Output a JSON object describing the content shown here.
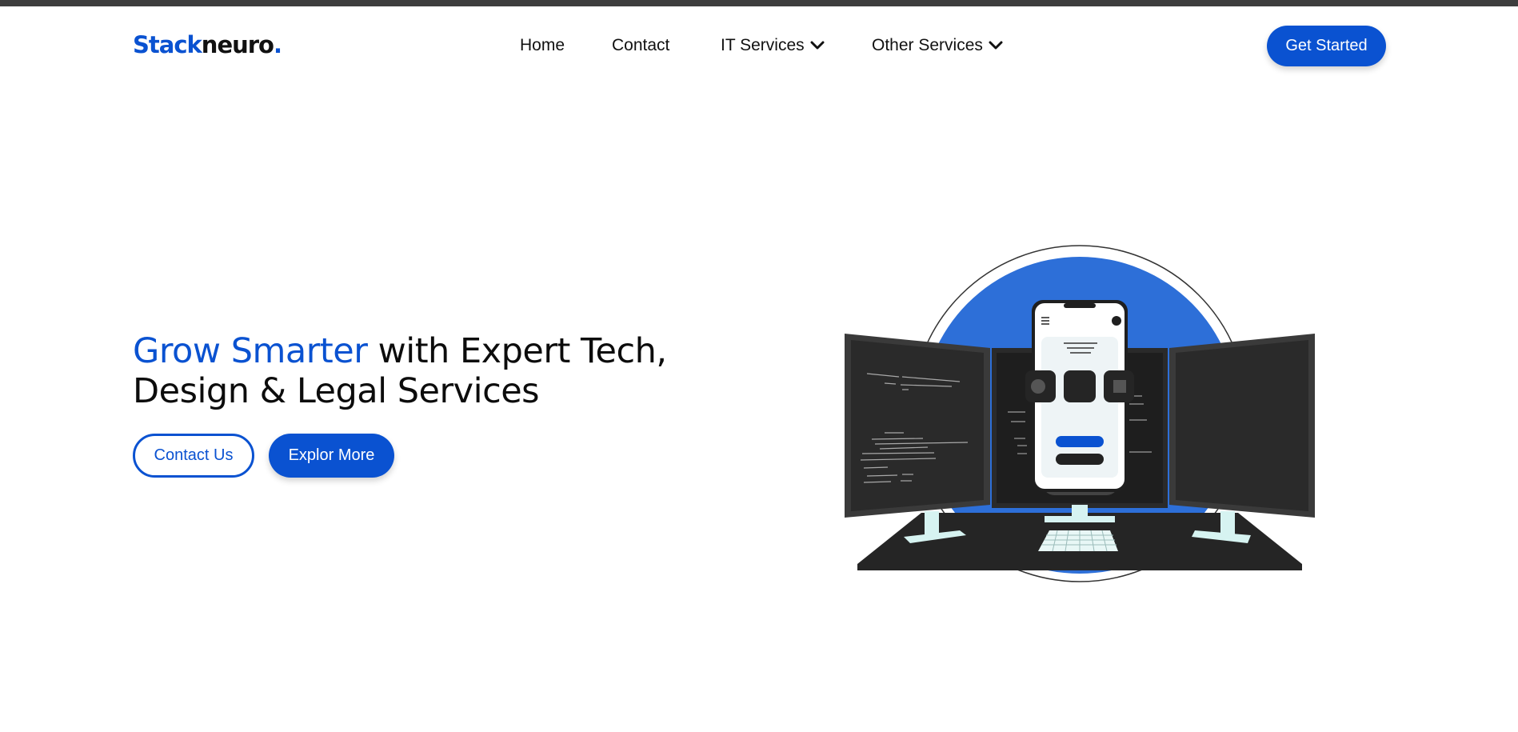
{
  "header": {
    "logo": {
      "part1": "Stack",
      "part2": "neuro",
      "part3": "."
    },
    "nav": [
      {
        "label": "Home",
        "has_dropdown": false
      },
      {
        "label": "Contact",
        "has_dropdown": false
      },
      {
        "label": "IT Services",
        "has_dropdown": true
      },
      {
        "label": "Other Services",
        "has_dropdown": true
      }
    ],
    "cta_label": "Get Started"
  },
  "hero": {
    "title_accent": "Grow Smarter",
    "title_rest_line1": " with Expert Tech,",
    "title_line2": "Design & Legal Services",
    "primary_button": "Contact Us",
    "secondary_button": "Explor More"
  },
  "colors": {
    "brand": "#0a52d1",
    "text": "#111111",
    "topbar": "#3d3d3d",
    "illustration_circle": "#2d6fd8",
    "monitor": "#2a2a2a",
    "desk": "#252525",
    "stand": "#d6f3f1"
  },
  "icons": {
    "dropdown": "chevron-down-icon",
    "illustration": "multi-monitor-workstation-illustration"
  }
}
